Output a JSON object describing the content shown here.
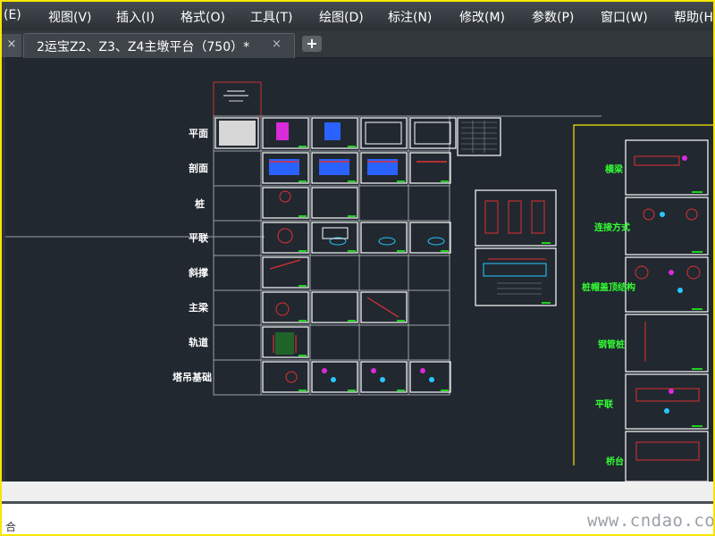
{
  "menu": {
    "items": [
      "(E)",
      "视图(V)",
      "插入(I)",
      "格式(O)",
      "工具(T)",
      "绘图(D)",
      "标注(N)",
      "修改(M)",
      "参数(P)",
      "窗口(W)",
      "帮助(H"
    ]
  },
  "tabs": {
    "left_close": "×",
    "active_title": "2运宝Z2、Z3、Z4主墩平台（750）*",
    "close_glyph": "×",
    "add_glyph": "+"
  },
  "drawing": {
    "row_labels": [
      "平面",
      "剖面",
      "桩",
      "平联",
      "斜撑",
      "主梁",
      "轨道",
      "塔吊基础"
    ],
    "right_labels": [
      "横梁",
      "连接方式",
      "桩帽盖顶结构",
      "钢管桩",
      "平联",
      "桥台"
    ]
  },
  "command_line": {
    "text": "合"
  },
  "watermark": "www.cndao.com",
  "colors": {
    "frame": "#f6e700",
    "canvas": "#212830",
    "sheet_border": "#ffffff",
    "label_green": "#33ff33",
    "outline_yellow": "#f6e700",
    "outline_red": "#c83232"
  }
}
